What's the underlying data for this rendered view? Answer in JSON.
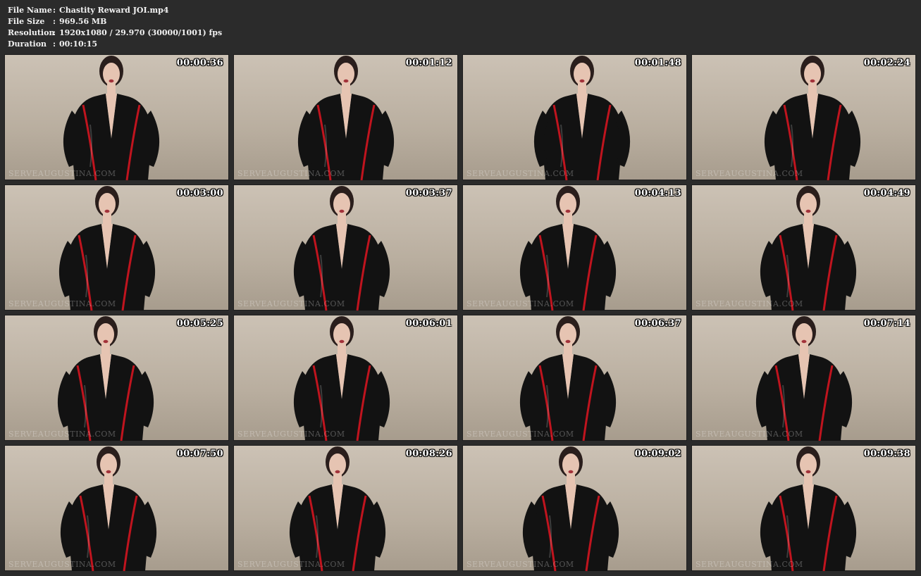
{
  "info": {
    "rows": [
      {
        "label": "File Name",
        "sep": ":",
        "value": "Chastity Reward JOI.mp4"
      },
      {
        "label": "File Size",
        "sep": ":",
        "value": "969.56 MB"
      },
      {
        "label": "Resolution",
        "sep": ":",
        "value": "1920x1080 / 29.970 (30000/1001) fps"
      },
      {
        "label": "Duration",
        "sep": ":",
        "value": "00:10:15"
      }
    ]
  },
  "watermark": "SERVEAUGUSTINA.COM",
  "colors": {
    "background": "#2b2b2b",
    "wall": "#c4b9ab",
    "suit": "#121212",
    "trim": "#c0141e",
    "skin": "#e6c4b2",
    "hair": "#2a1e1c"
  },
  "thumbnails": [
    {
      "timestamp": "00:00:36"
    },
    {
      "timestamp": "00:01:12"
    },
    {
      "timestamp": "00:01:48"
    },
    {
      "timestamp": "00:02:24"
    },
    {
      "timestamp": "00:03:00"
    },
    {
      "timestamp": "00:03:37"
    },
    {
      "timestamp": "00:04:13"
    },
    {
      "timestamp": "00:04:49"
    },
    {
      "timestamp": "00:05:25"
    },
    {
      "timestamp": "00:06:01"
    },
    {
      "timestamp": "00:06:37"
    },
    {
      "timestamp": "00:07:14"
    },
    {
      "timestamp": "00:07:50"
    },
    {
      "timestamp": "00:08:26"
    },
    {
      "timestamp": "00:09:02"
    },
    {
      "timestamp": "00:09:38"
    }
  ]
}
